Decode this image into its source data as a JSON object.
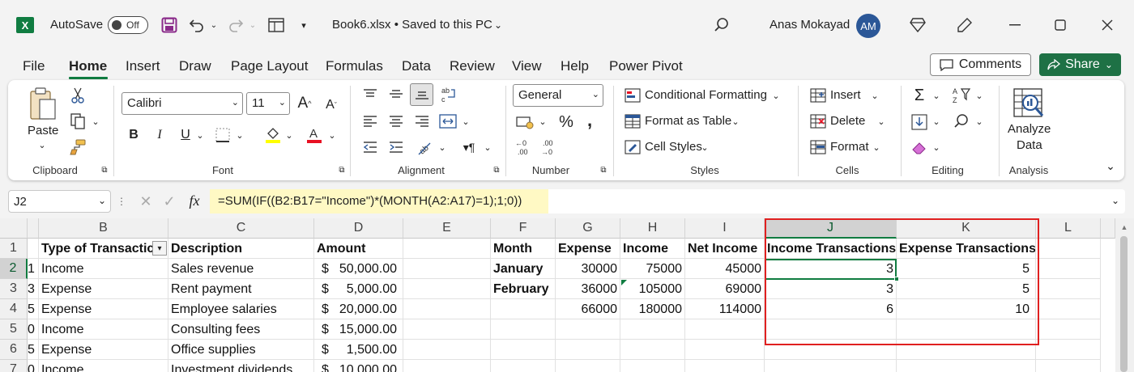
{
  "titlebar": {
    "autosave_label": "AutoSave",
    "autosave_state": "Off",
    "file_title": "Book6.xlsx • Saved to this PC",
    "user_name": "Anas Mokayad",
    "user_initials": "AM"
  },
  "menu": {
    "tabs": [
      "File",
      "Home",
      "Insert",
      "Draw",
      "Page Layout",
      "Formulas",
      "Data",
      "Review",
      "View",
      "Help",
      "Power Pivot"
    ],
    "active": "Home",
    "comments_label": "Comments",
    "share_label": "Share"
  },
  "ribbon": {
    "clipboard": {
      "paste": "Paste",
      "label": "Clipboard"
    },
    "font": {
      "name": "Calibri",
      "size": "11",
      "label": "Font"
    },
    "alignment": {
      "label": "Alignment"
    },
    "number": {
      "format": "General",
      "label": "Number"
    },
    "styles": {
      "conditional": "Conditional Formatting",
      "format_table": "Format as Table",
      "cell_styles": "Cell Styles",
      "label": "Styles"
    },
    "cells": {
      "insert": "Insert",
      "delete": "Delete",
      "format": "Format",
      "label": "Cells"
    },
    "editing": {
      "label": "Editing"
    },
    "analysis": {
      "analyze1": "Analyze",
      "analyze2": "Data",
      "label": "Analysis"
    }
  },
  "formula_bar": {
    "name_box": "J2",
    "fx": "fx",
    "formula": "=SUM(IF((B2:B17=\"Income\")*(MONTH(A2:A17)=1);1;0))"
  },
  "sheet": {
    "columns": [
      "B",
      "C",
      "D",
      "E",
      "F",
      "G",
      "H",
      "I",
      "J",
      "K",
      "L"
    ],
    "rows": [
      "1",
      "2",
      "3",
      "4",
      "5",
      "6",
      "7"
    ],
    "a_col": [
      "1",
      "3",
      "5",
      "0",
      "5",
      "0"
    ],
    "headers": {
      "B": "Type of Transactic",
      "C": "Description",
      "D": "Amount",
      "F": "Month",
      "G": "Expense",
      "H": "Income",
      "I": "Net Income",
      "J": "Income Transactions",
      "K": "Expense Transactions"
    },
    "transactions": [
      {
        "type": "Income",
        "desc": "Sales revenue",
        "amount": "50,000.00"
      },
      {
        "type": "Expense",
        "desc": "Rent payment",
        "amount": "5,000.00"
      },
      {
        "type": "Expense",
        "desc": "Employee salaries",
        "amount": "20,000.00"
      },
      {
        "type": "Income",
        "desc": "Consulting fees",
        "amount": "15,000.00"
      },
      {
        "type": "Expense",
        "desc": "Office supplies",
        "amount": "1,500.00"
      },
      {
        "type": "Income",
        "desc": "Investment dividends",
        "amount": "10,000.00"
      }
    ],
    "currency": "$",
    "summary": [
      {
        "month": "January",
        "expense": "30000",
        "income": "75000",
        "net": "45000",
        "inc_tx": "3",
        "exp_tx": "5"
      },
      {
        "month": "February",
        "expense": "36000",
        "income": "105000",
        "net": "69000",
        "inc_tx": "3",
        "exp_tx": "5"
      },
      {
        "month": "",
        "expense": "66000",
        "income": "180000",
        "net": "114000",
        "inc_tx": "6",
        "exp_tx": "10"
      }
    ]
  }
}
